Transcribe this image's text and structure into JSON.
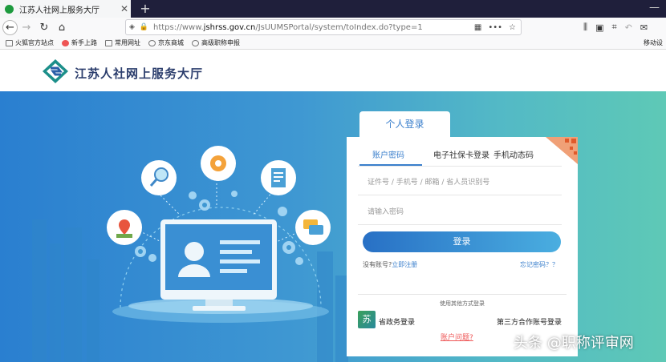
{
  "browser": {
    "tab_title": "江苏人社网上服务大厅",
    "url_prefix": "https://www.",
    "url_domain": "jshrss.gov.cn",
    "url_path": "/JsUUMSPortal/system/toIndex.do?type=1"
  },
  "bookmarks": [
    "火狐官方站点",
    "新手上路",
    "常用网址",
    "京东商城",
    "高级职称申报"
  ],
  "bookmarks_right": "移动设",
  "site": {
    "title": "江苏人社网上服务大厅"
  },
  "login": {
    "panel_title": "个人登录",
    "tabs": [
      "账户密码",
      "电子社保卡登录",
      "手机动态码"
    ],
    "id_placeholder": "证件号 / 手机号 / 邮箱 / 省人员识别号",
    "password_placeholder": "请输入密码",
    "login_button": "登录",
    "no_account": "没有账号?",
    "register": "立即注册",
    "forgot": "忘记密码？？",
    "other_methods": "使用其他方式登录",
    "gov_login": "省政务登录",
    "gov_icon_char": "苏",
    "third_party_login": "第三方合作账号登录",
    "account_problem": "账户问题?"
  },
  "watermark": "头条 @职称评审网",
  "colors": {
    "accent": "#3a7fcc",
    "title": "#2c3e6d",
    "problem": "#e55555"
  },
  "icons": [
    "magnifier-icon",
    "gear-icon",
    "document-icon",
    "location-pin-icon",
    "chat-bubble-icon",
    "user-icon"
  ]
}
